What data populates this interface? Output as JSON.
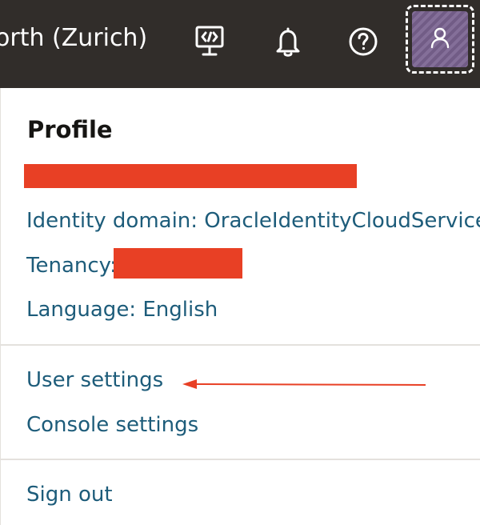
{
  "header": {
    "region_label": "orth (Zurich)",
    "icons": {
      "developer": "developer-tools-icon",
      "notifications": "bell-icon",
      "help": "help-icon",
      "profile": "user-icon"
    }
  },
  "profile_menu": {
    "heading": "Profile",
    "identity_domain": "Identity domain: OracleIdentityCloudService",
    "tenancy_label": "Tenancy:",
    "language": "Language: English",
    "user_settings": "User settings",
    "console_settings": "Console settings",
    "sign_out": "Sign out"
  },
  "colors": {
    "topbar": "#312d2a",
    "link": "#1d5c7a",
    "redaction": "#e84025",
    "avatar": "#7b6491",
    "annotation_arrow": "#e84025"
  }
}
